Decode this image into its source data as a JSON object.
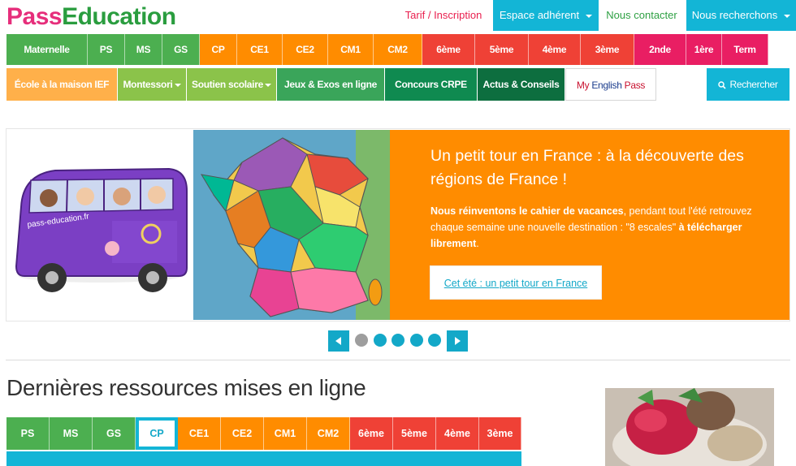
{
  "header": {
    "logo_pass": "Pass",
    "logo_edu": "Education",
    "tarif": "Tarif / Inscription",
    "espace": "Espace adhérent",
    "contact": "Nous contacter",
    "recherchons": "Nous recherchons"
  },
  "levels": [
    {
      "label": "Maternelle",
      "color": "#4caf50"
    },
    {
      "label": "PS",
      "color": "#4caf50"
    },
    {
      "label": "MS",
      "color": "#4caf50"
    },
    {
      "label": "GS",
      "color": "#4caf50"
    },
    {
      "label": "CP",
      "color": "#ff8c00"
    },
    {
      "label": "CE1",
      "color": "#ff8c00"
    },
    {
      "label": "CE2",
      "color": "#ff8c00"
    },
    {
      "label": "CM1",
      "color": "#ff8c00"
    },
    {
      "label": "CM2",
      "color": "#ff8c00"
    },
    {
      "label": "6ème",
      "color": "#ef4136"
    },
    {
      "label": "5ème",
      "color": "#ef4136"
    },
    {
      "label": "4ème",
      "color": "#ef4136"
    },
    {
      "label": "3ème",
      "color": "#ef4136"
    },
    {
      "label": "2nde",
      "color": "#e91e63"
    },
    {
      "label": "1ère",
      "color": "#e91e63"
    },
    {
      "label": "Term",
      "color": "#e91e63"
    }
  ],
  "categories": {
    "ief": "École à la maison IEF",
    "montessori": "Montessori",
    "soutien": "Soutien scolaire",
    "jeux": "Jeux & Exos en ligne",
    "concours": "Concours CRPE",
    "actus": "Actus & Conseils",
    "english_a": "My ",
    "english_b": "English",
    "english_c": " Pass",
    "search": "Rechercher"
  },
  "slide": {
    "title": "Un petit tour en France : à la découverte des régions de France !",
    "text_bold": "Nous réinventons le cahier de vacances",
    "text_rest": ", pendant tout l'été retrouvez chaque semaine une nouvelle destination : \"8 escales\"",
    "text_bold2": "à télécharger librement",
    "text_end": ".",
    "button": "Cet été : un petit tour en France",
    "bus_text": "pass-education.fr"
  },
  "slider_controls": {
    "dots": 5,
    "active_dot": 0
  },
  "resources": {
    "title": "Dernières ressources mises en ligne",
    "tabs": [
      {
        "label": "PS",
        "color": "#4caf50"
      },
      {
        "label": "MS",
        "color": "#4caf50"
      },
      {
        "label": "GS",
        "color": "#4caf50"
      },
      {
        "label": "CP",
        "color": "#13b5d6"
      },
      {
        "label": "CE1",
        "color": "#ff8c00"
      },
      {
        "label": "CE2",
        "color": "#ff8c00"
      },
      {
        "label": "CM1",
        "color": "#ff8c00"
      },
      {
        "label": "CM2",
        "color": "#ff8c00"
      },
      {
        "label": "6ème",
        "color": "#ef4136"
      },
      {
        "label": "5ème",
        "color": "#ef4136"
      },
      {
        "label": "4ème",
        "color": "#ef4136"
      },
      {
        "label": "3ème",
        "color": "#ef4136"
      }
    ],
    "active_tab": "CP"
  },
  "colors": {
    "accent_cyan": "#13b5d6",
    "green": "#4caf50",
    "orange": "#ff8c00",
    "red": "#ef4136",
    "pink": "#e91e63"
  }
}
